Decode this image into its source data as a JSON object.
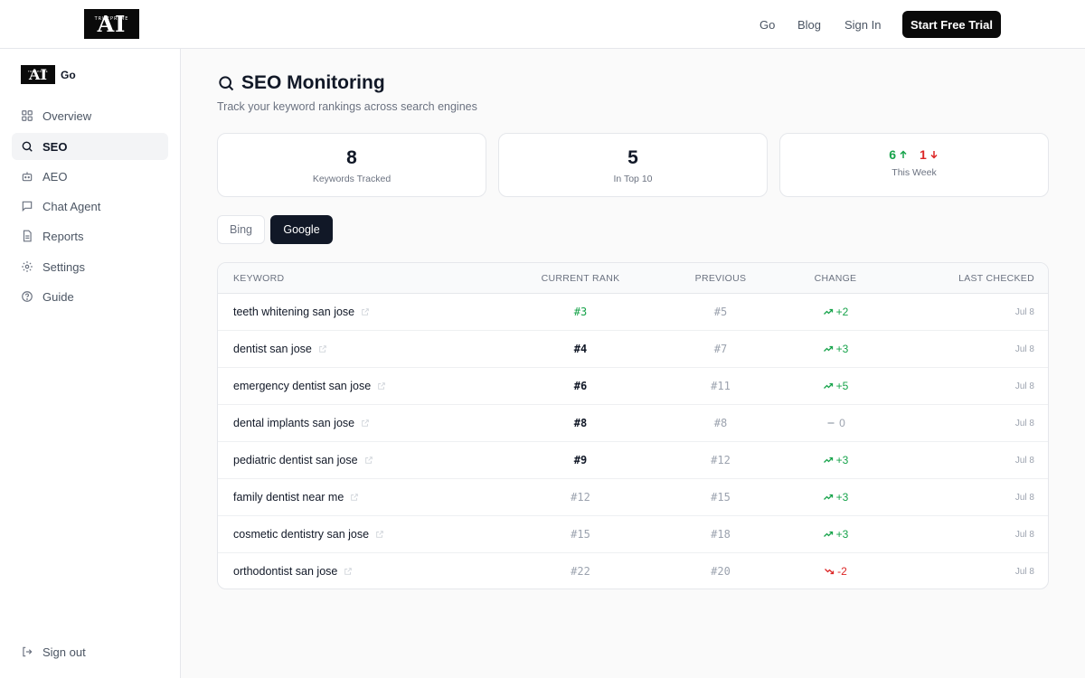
{
  "topbar": {
    "logo": {
      "main": "AI",
      "small": "TRUEPRIME"
    },
    "nav": [
      "Go",
      "Blog",
      "Sign In"
    ],
    "trial_button": "Start Free Trial"
  },
  "sidebar": {
    "logo": {
      "main": "AI",
      "small": "TRUEPRIME"
    },
    "brand": "Go",
    "items": [
      {
        "label": "Overview",
        "icon": "grid-icon",
        "active": false
      },
      {
        "label": "SEO",
        "icon": "search-icon",
        "active": true
      },
      {
        "label": "AEO",
        "icon": "bot-icon",
        "active": false
      },
      {
        "label": "Chat Agent",
        "icon": "chat-icon",
        "active": false
      },
      {
        "label": "Reports",
        "icon": "document-icon",
        "active": false
      },
      {
        "label": "Settings",
        "icon": "gear-icon",
        "active": false
      },
      {
        "label": "Guide",
        "icon": "help-circle-icon",
        "active": false
      }
    ],
    "signout": "Sign out"
  },
  "page": {
    "title": "SEO Monitoring",
    "subtitle": "Track your keyword rankings across search engines"
  },
  "stats": {
    "tracked": {
      "value": "8",
      "label": "Keywords Tracked"
    },
    "top10": {
      "value": "5",
      "label": "In Top 10"
    },
    "week": {
      "up": "6",
      "down": "1",
      "label": "This Week"
    }
  },
  "tabs": {
    "bing": "Bing",
    "google": "Google",
    "active": "Google"
  },
  "table": {
    "headers": {
      "keyword": "KEYWORD",
      "current": "CURRENT RANK",
      "previous": "PREVIOUS",
      "change": "CHANGE",
      "last_checked": "LAST CHECKED"
    },
    "rows": [
      {
        "keyword": "teeth whitening san jose",
        "current": "#3",
        "previous": "#5",
        "change": "+2",
        "trend": "up",
        "tier": "top3",
        "date": "Jul 8"
      },
      {
        "keyword": "dentist san jose",
        "current": "#4",
        "previous": "#7",
        "change": "+3",
        "trend": "up",
        "tier": "top10",
        "date": "Jul 8"
      },
      {
        "keyword": "emergency dentist san jose",
        "current": "#6",
        "previous": "#11",
        "change": "+5",
        "trend": "up",
        "tier": "top10",
        "date": "Jul 8"
      },
      {
        "keyword": "dental implants san jose",
        "current": "#8",
        "previous": "#8",
        "change": "0",
        "trend": "flat",
        "tier": "top10",
        "date": "Jul 8"
      },
      {
        "keyword": "pediatric dentist san jose",
        "current": "#9",
        "previous": "#12",
        "change": "+3",
        "trend": "up",
        "tier": "top10",
        "date": "Jul 8"
      },
      {
        "keyword": "family dentist near me",
        "current": "#12",
        "previous": "#15",
        "change": "+3",
        "trend": "up",
        "tier": "other",
        "date": "Jul 8"
      },
      {
        "keyword": "cosmetic dentistry san jose",
        "current": "#15",
        "previous": "#18",
        "change": "+3",
        "trend": "up",
        "tier": "other",
        "date": "Jul 8"
      },
      {
        "keyword": "orthodontist san jose",
        "current": "#22",
        "previous": "#20",
        "change": "-2",
        "trend": "down",
        "tier": "other",
        "date": "Jul 8"
      }
    ]
  },
  "colors": {
    "accent_dark": "#0a0a0a",
    "up": "#16a34a",
    "down": "#dc2626",
    "muted": "#9ca3af"
  }
}
